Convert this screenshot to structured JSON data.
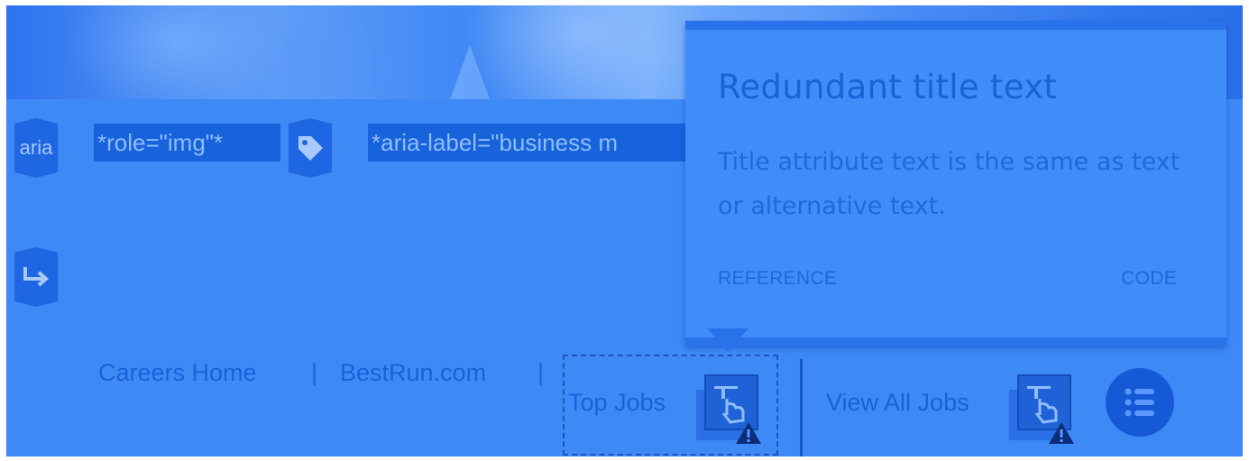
{
  "hero": {
    "description": ""
  },
  "aria_badge": {
    "label": "aria"
  },
  "highlights": {
    "role": "*role=\"img\"*",
    "aria_label": "*aria-label=\"business m"
  },
  "tooltip": {
    "title": "Redundant title text",
    "description": "Title attribute text is the same as text or alternative text.",
    "reference_label": "REFERENCE",
    "code_label": "CODE"
  },
  "nav": {
    "careers_home": "Careers Home",
    "separator": "|",
    "bestrun": "BestRun.com",
    "top_jobs": "Top Jobs",
    "view_all_jobs": "View All Jobs"
  },
  "colors": {
    "overlay": "#3d8af7",
    "badge": "#1f66e3",
    "highlight": "#1763dc",
    "nav_text": "#1b61d9",
    "warning": "#0c2d7a"
  },
  "icons": [
    "tag-icon",
    "redirect-arrow-icon",
    "touch-target-warning-icon",
    "menu-list-icon"
  ]
}
